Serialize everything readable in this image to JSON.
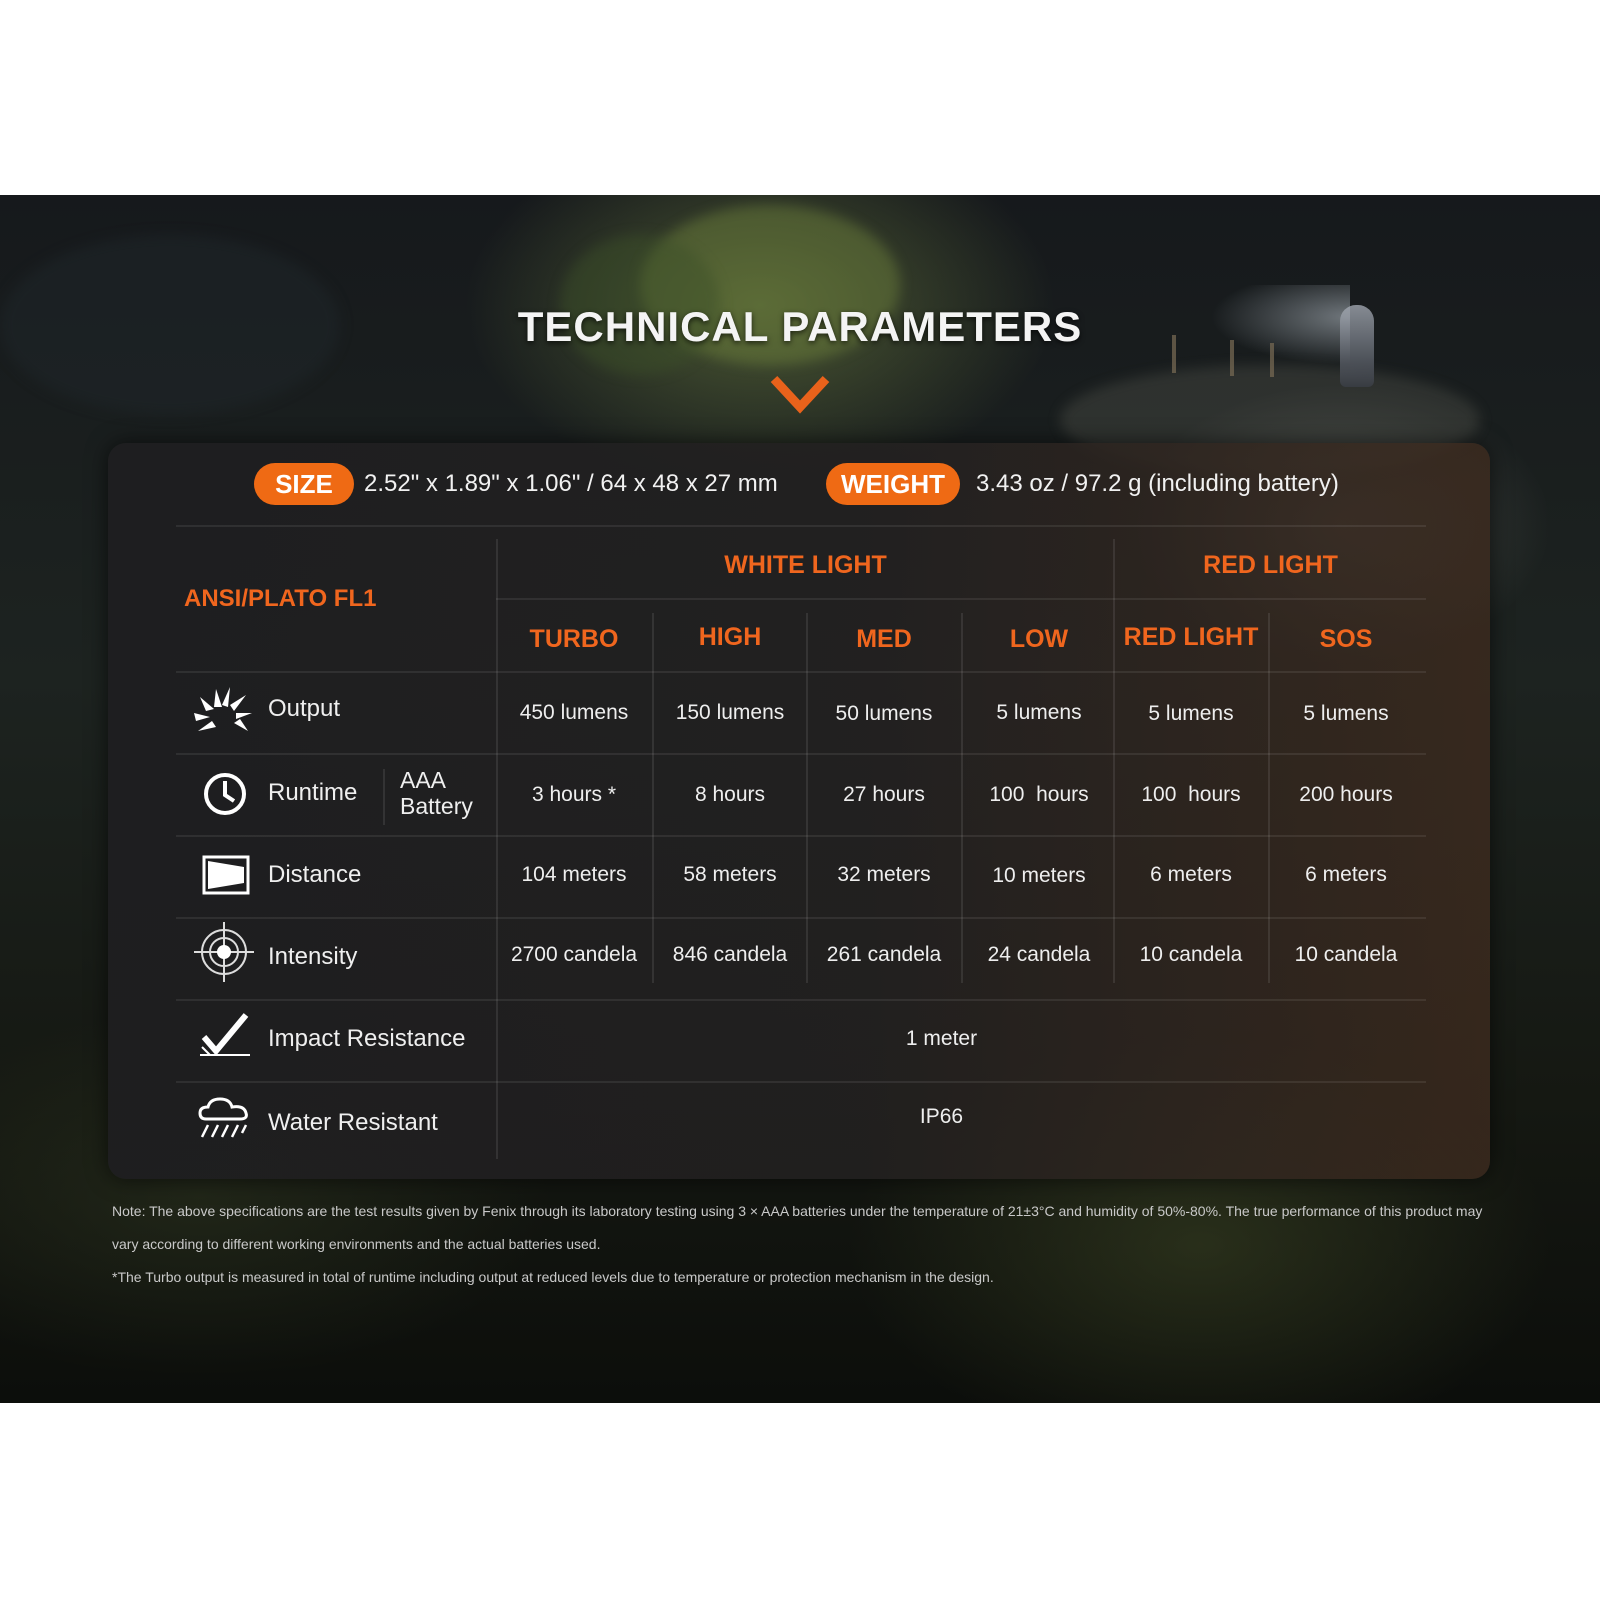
{
  "title": "TECHNICAL PARAMETERS",
  "size": {
    "label": "SIZE",
    "value": "2.52\" x 1.89\" x 1.06\" / 64 x 48 x 27 mm"
  },
  "weight": {
    "label": "WEIGHT",
    "value": "3.43 oz / 97.2 g (including battery)"
  },
  "table": {
    "standard": "ANSI/PLATO FL1",
    "groups": [
      "WHITE LIGHT",
      "RED LIGHT"
    ],
    "modes": [
      "TURBO",
      "HIGH",
      "MED",
      "LOW",
      "RED LIGHT",
      "SOS"
    ],
    "rows": {
      "output": {
        "label": "Output",
        "values": [
          "450 lumens",
          "150 lumens",
          "50 lumens",
          "5 lumens",
          "5 lumens",
          "5 lumens"
        ]
      },
      "runtime": {
        "label": "Runtime",
        "sublabel": "AAA Battery",
        "values": [
          "3 hours *",
          "8 hours",
          "27 hours",
          "100  hours",
          "100  hours",
          "200 hours"
        ]
      },
      "distance": {
        "label": "Distance",
        "values": [
          "104 meters",
          "58 meters",
          "32 meters",
          "10 meters",
          "6 meters",
          "6 meters"
        ]
      },
      "intensity": {
        "label": "Intensity",
        "values": [
          "2700 candela",
          "846 candela",
          "261 candela",
          "24 candela",
          "10 candela",
          "10 candela"
        ]
      },
      "impact": {
        "label": "Impact Resistance",
        "value": "1 meter"
      },
      "water": {
        "label": "Water Resistant",
        "value": "IP66"
      }
    }
  },
  "notes": [
    "Note: The above specifications are the test results given by Fenix through its laboratory testing using 3 × AAA batteries under the temperature of 21±3°C and humidity of 50%-80%. The true performance of this product may vary according to different working environments and the actual batteries used.",
    "*The Turbo output is measured in total of runtime including output at reduced levels due to temperature or protection mechanism in the design."
  ],
  "colors": {
    "accent": "#ef6a14",
    "header_text": "#f0661e",
    "panel": "#1f1f21"
  },
  "icons": [
    "output-burst-icon",
    "clock-icon",
    "beam-distance-icon",
    "target-intensity-icon",
    "impact-check-icon",
    "rain-cloud-icon",
    "chevron-down-icon"
  ]
}
